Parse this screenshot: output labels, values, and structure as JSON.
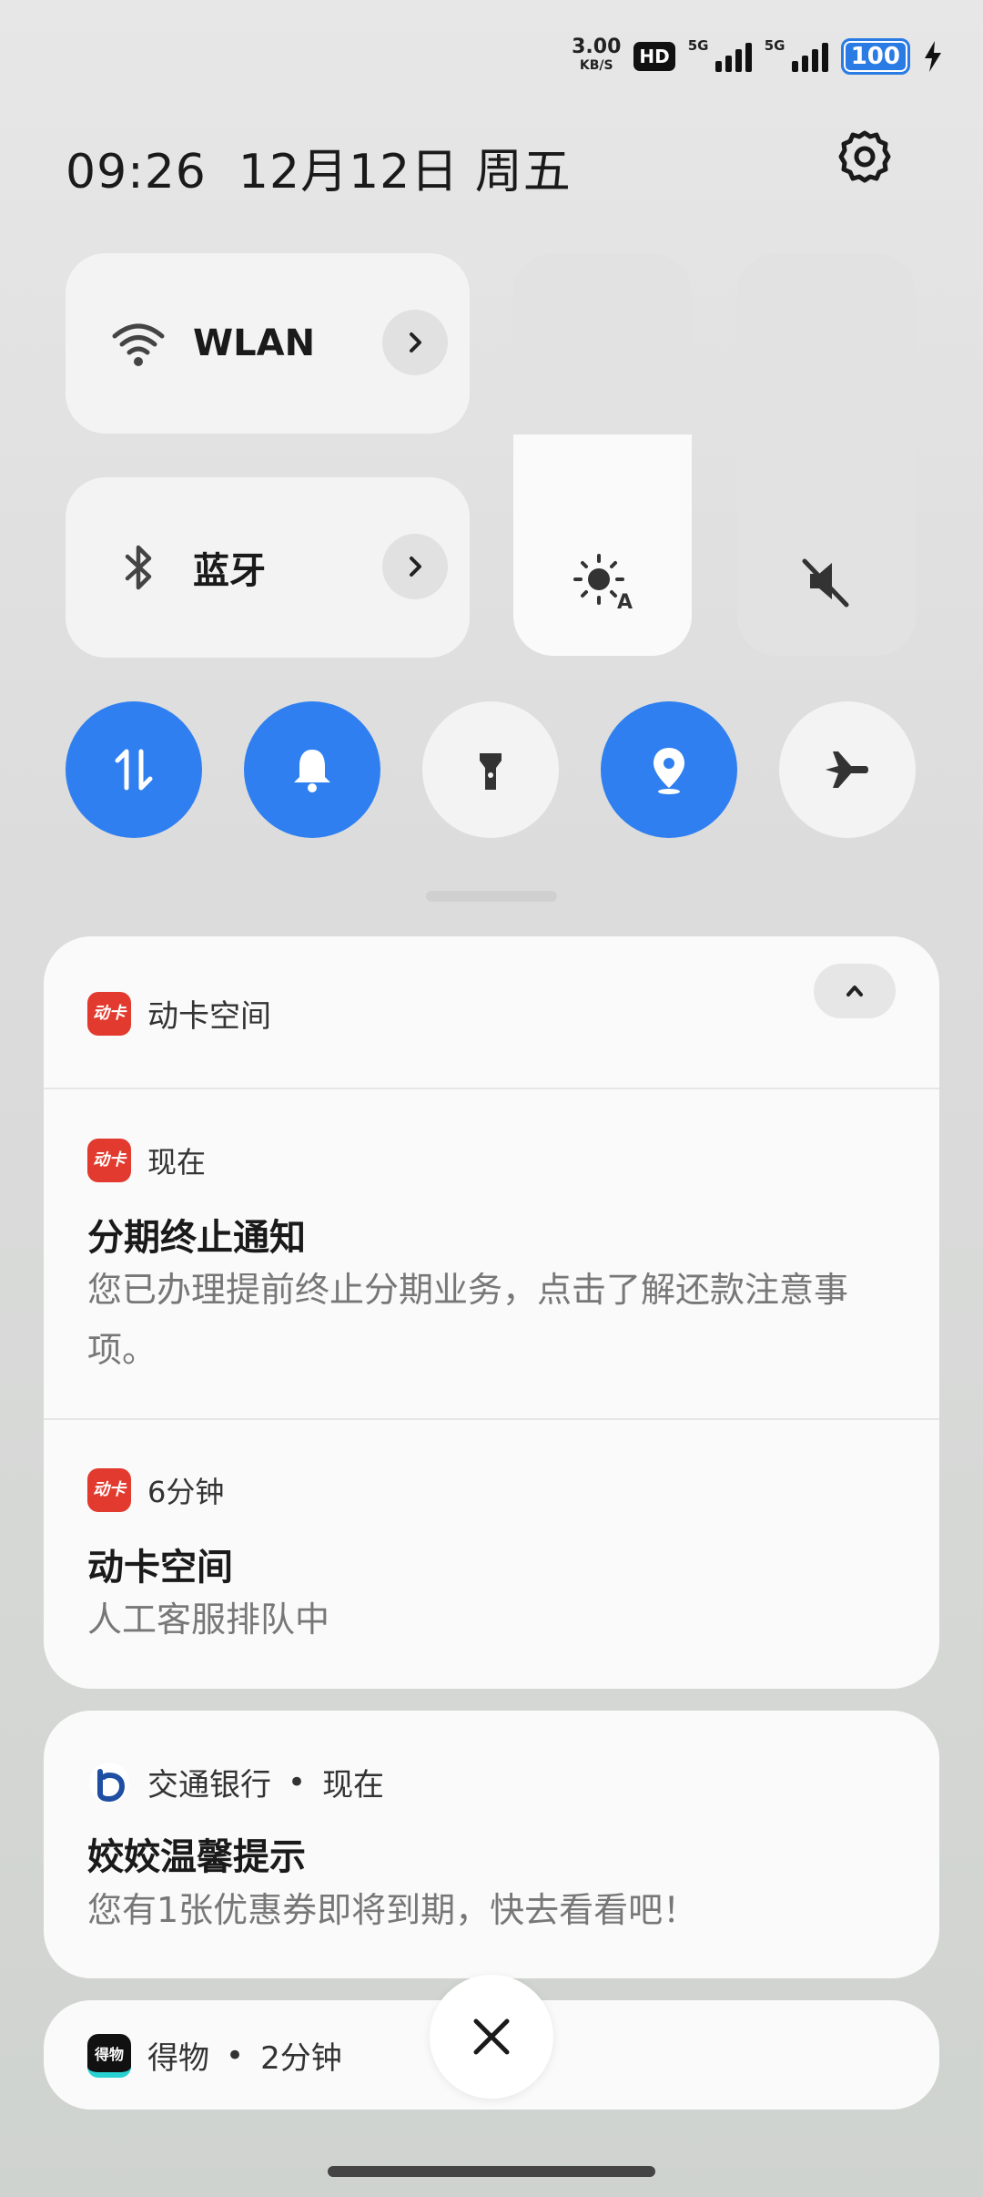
{
  "status_bar": {
    "net_speed": "3.00",
    "net_unit": "KB/S",
    "hd_label": "HD",
    "signal1_label": "5G",
    "signal2_label": "5G",
    "battery": "100"
  },
  "header": {
    "time": "09:26",
    "date": "12月12日",
    "weekday": "周五"
  },
  "tiles": {
    "wlan_label": "WLAN",
    "bluetooth_label": "蓝牙"
  },
  "sliders": {
    "brightness_level": 0.55,
    "volume_level": 0.0
  },
  "toggles": [
    {
      "name": "mobile-data",
      "on": true
    },
    {
      "name": "ring",
      "on": true
    },
    {
      "name": "flashlight",
      "on": false
    },
    {
      "name": "location",
      "on": true
    },
    {
      "name": "airplane",
      "on": false
    }
  ],
  "notifications": {
    "group1": {
      "app_name": "动卡空间",
      "items": [
        {
          "time": "现在",
          "title": "分期终止通知",
          "body": "您已办理提前终止分期业务，点击了解还款注意事项。"
        },
        {
          "time": "6分钟",
          "title": "动卡空间",
          "body": "人工客服排队中"
        }
      ]
    },
    "group2": {
      "app_name": "交通银行",
      "time": "现在",
      "title": "姣姣温馨提示",
      "body": "您有1张优惠券即将到期，快去看看吧！"
    },
    "group3": {
      "app_name": "得物",
      "time": "2分钟"
    }
  },
  "app_icon_text": {
    "dongka": "动卡",
    "dewu": "得物"
  },
  "colors": {
    "accent": "#2f7ff0",
    "battery": "#2a7be4",
    "dongka_red": "#e23a2e",
    "bocom_blue": "#1f4fa3"
  }
}
